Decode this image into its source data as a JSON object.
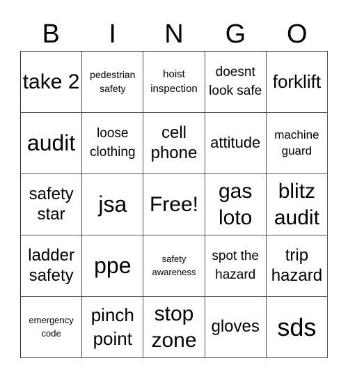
{
  "header": [
    "B",
    "I",
    "N",
    "G",
    "O"
  ],
  "cells": [
    {
      "text": "take 2",
      "size": "s30"
    },
    {
      "text": "pedestrian safety",
      "size": "s14"
    },
    {
      "text": "hoist inspection",
      "size": "s15"
    },
    {
      "text": "doesnt look safe",
      "size": "s19"
    },
    {
      "text": "forklift",
      "size": "s26"
    },
    {
      "text": "audit",
      "size": "s32"
    },
    {
      "text": "loose clothing",
      "size": "s19"
    },
    {
      "text": "cell phone",
      "size": "s24"
    },
    {
      "text": "attitude",
      "size": "s22"
    },
    {
      "text": "machine guard",
      "size": "s17"
    },
    {
      "text": "safety star",
      "size": "s24"
    },
    {
      "text": "jsa",
      "size": "s32"
    },
    {
      "text": "Free!",
      "size": "s30"
    },
    {
      "text": "gas loto",
      "size": "s30"
    },
    {
      "text": "blitz audit",
      "size": "s30"
    },
    {
      "text": "ladder safety",
      "size": "s24"
    },
    {
      "text": "ppe",
      "size": "s32"
    },
    {
      "text": "safety awareness",
      "size": "s13"
    },
    {
      "text": "spot the hazard",
      "size": "s19"
    },
    {
      "text": "trip hazard",
      "size": "s24"
    },
    {
      "text": "emergency code",
      "size": "s13"
    },
    {
      "text": "pinch point",
      "size": "s26"
    },
    {
      "text": "stop zone",
      "size": "s30"
    },
    {
      "text": "gloves",
      "size": "s24"
    },
    {
      "text": "sds",
      "size": "s36"
    }
  ]
}
